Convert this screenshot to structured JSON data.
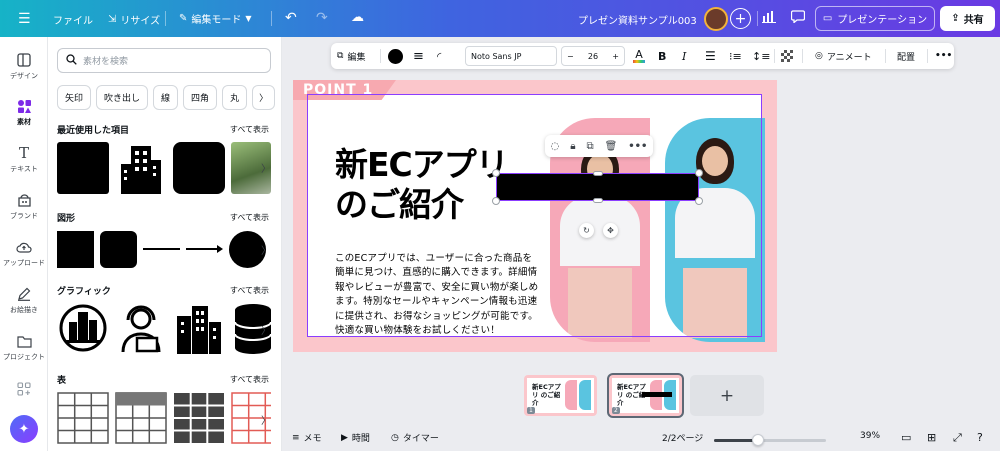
{
  "topbar": {
    "menu_icon": "hamburger-icon",
    "file_label": "ファイル",
    "resize_label": "リサイズ",
    "edit_mode_label": "編集モード",
    "doc_title": "プレゼン資料サンプル003",
    "present_label": "プレゼンテーション",
    "share_label": "共有"
  },
  "rail": {
    "items": [
      {
        "label": "デザイン",
        "icon": "layout-icon"
      },
      {
        "label": "素材",
        "icon": "elements-icon"
      },
      {
        "label": "テキスト",
        "icon": "text-icon"
      },
      {
        "label": "ブランド",
        "icon": "brand-icon"
      },
      {
        "label": "アップロード",
        "icon": "cloud-upload-icon"
      },
      {
        "label": "お絵描き",
        "icon": "pen-icon"
      },
      {
        "label": "プロジェクト",
        "icon": "folder-icon"
      }
    ]
  },
  "panel": {
    "search_placeholder": "素材を検索",
    "chips": [
      "矢印",
      "吹き出し",
      "線",
      "四角",
      "丸"
    ],
    "see_all": "すべて表示",
    "sections": [
      "最近使用した項目",
      "図形",
      "グラフィック",
      "表"
    ]
  },
  "toolbar": {
    "edit_label": "編集",
    "font_name": "Noto Sans JP",
    "font_size": "26",
    "animate_label": "アニメート",
    "position_label": "配置"
  },
  "slide": {
    "tag": "POINT 1",
    "headline_line1": "新ECアプリ",
    "headline_line2": "のご紹介",
    "body": "このECアプリでは、ユーザーに合った商品を簡単に見つけ、直感的に購入できます。詳細情報やレビューが豊富で、安全に買い物が楽しめます。特別なセールやキャンペーン情報も迅速に提供され、お得なショッピングが可能です。快適な買い物体験をお試しください！"
  },
  "thumbs": [
    {
      "title": "新ECアプリ のご紹介",
      "num": "1"
    },
    {
      "title": "新ECアプリ のご紹介",
      "num": "2"
    }
  ],
  "bottom": {
    "notes_label": "メモ",
    "time_label": "時間",
    "timer_label": "タイマー",
    "page_indicator": "2/2ページ",
    "zoom": "39%"
  },
  "zoom_fraction": 0.39,
  "colors": {
    "accent": "#8b3dff",
    "slide_bg": "#fbc6cb",
    "photo_pink": "#f6a8b8",
    "photo_blue": "#5ac4e0"
  }
}
